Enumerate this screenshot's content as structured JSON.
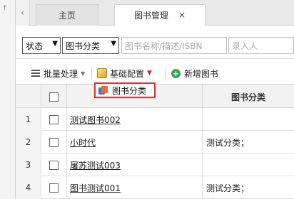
{
  "window": {
    "pin_glyph": "†"
  },
  "tabs": {
    "prev_glyph": "‹",
    "items": [
      {
        "label": "主页"
      },
      {
        "label": "图书管理",
        "close": "×"
      }
    ]
  },
  "filters": {
    "status_select": "状态",
    "category_select": "图书分类",
    "search_placeholder": "图书名称/描述/ISBN",
    "entry_placeholder": "录入人"
  },
  "toolbar": {
    "batch_label": "批量处理",
    "config_label": "基础配置",
    "add_label": "新增图书",
    "caret": "▼"
  },
  "dropdown": {
    "item_label": "图书分类"
  },
  "table": {
    "headers": {
      "category": "图书分类"
    },
    "rows": [
      {
        "index": "1",
        "name": "测试图书002",
        "category": ""
      },
      {
        "index": "2",
        "name": "小时代",
        "category": "测试分类；"
      },
      {
        "index": "3",
        "name": "屠苏测试003",
        "category": ""
      },
      {
        "index": "4",
        "name": "图书测试001",
        "category": "测试分类；"
      }
    ]
  },
  "colors": {
    "highlight_border": "#e03030",
    "add_icon": "#3aa54a"
  }
}
